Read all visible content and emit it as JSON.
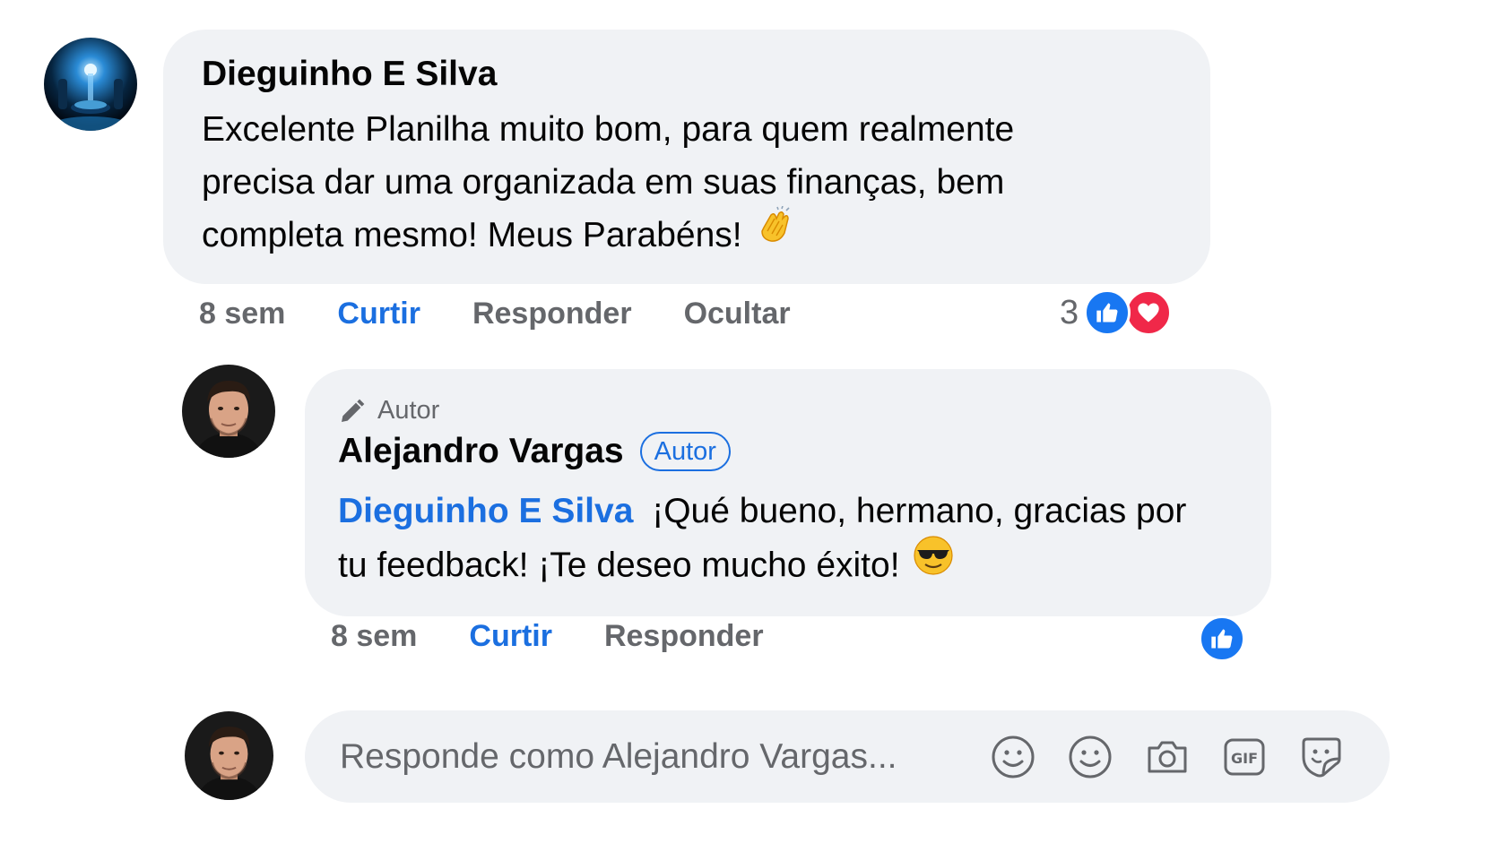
{
  "comment1": {
    "author": "Dieguinho E Silva",
    "text_lines": [
      "Excelente Planilha muito bom, para quem realmente",
      "precisa dar uma organizada em suas finanças, bem",
      "completa mesmo! Meus Parabéns!"
    ],
    "emoji": "clapping-hands-emoji",
    "time": "8 sem",
    "like_label": "Curtir",
    "reply_label": "Responder",
    "hide_label": "Ocultar",
    "reaction_count": "3",
    "reactions": [
      "like-icon",
      "love-icon"
    ]
  },
  "reply1": {
    "author_label": "Autor",
    "author": "Alejandro Vargas",
    "badge": "Autor",
    "mention": "Dieguinho E Silva",
    "text_line1": "¡Qué bueno, hermano, gracias por",
    "text_line2": "tu feedback! ¡Te deseo mucho éxito!",
    "emoji": "sunglasses-emoji",
    "time": "8 sem",
    "like_label": "Curtir",
    "reply_label": "Responder",
    "reactions": [
      "like-icon"
    ]
  },
  "reply_box": {
    "placeholder": "Responde como Alejandro Vargas...",
    "icons": [
      "emoji-icon",
      "smiley-icon",
      "camera-icon",
      "gif-icon",
      "sticker-icon"
    ]
  },
  "colors": {
    "bubble": "#f0f2f5",
    "link_blue": "#1b6fe0",
    "like_blue": "#1877f2",
    "love_red": "#f02849",
    "meta_gray": "#65676b"
  }
}
